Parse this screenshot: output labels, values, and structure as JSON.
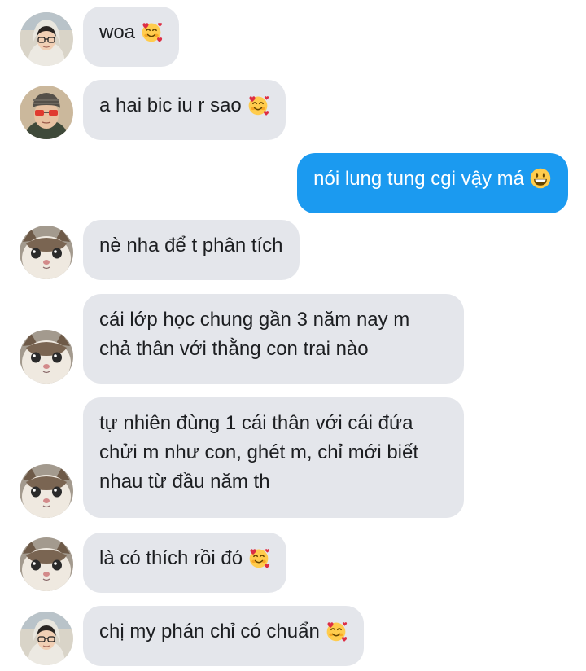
{
  "colors": {
    "incoming_bubble": "#e4e6eb",
    "outgoing_bubble": "#1b9af0",
    "incoming_text": "#1c1e21",
    "outgoing_text": "#ffffff"
  },
  "messages": [
    {
      "direction": "incoming",
      "avatar": "boy-hoodie-avatar",
      "lines": [
        "woa"
      ],
      "emoji": "smiling-face-with-hearts"
    },
    {
      "direction": "incoming",
      "avatar": "boy-red-glasses-avatar",
      "lines": [
        "a hai bic iu r sao"
      ],
      "emoji": "smiling-face-with-hearts"
    },
    {
      "direction": "outgoing",
      "lines": [
        "nói lung tung cgi vậy má"
      ],
      "emoji": "grinning-face"
    },
    {
      "direction": "incoming",
      "avatar": "cat-avatar",
      "lines": [
        "nè nha để t phân tích"
      ]
    },
    {
      "direction": "incoming",
      "avatar": "cat-avatar",
      "lines": [
        "cái lớp học chung gần 3 năm nay m",
        "chả thân với thằng con trai nào"
      ]
    },
    {
      "direction": "incoming",
      "avatar": "cat-avatar",
      "lines": [
        "tự nhiên đùng 1 cái thân với cái đứa",
        "chửi m như con, ghét m, chỉ mới biết",
        "nhau từ đầu năm th"
      ]
    },
    {
      "direction": "incoming",
      "avatar": "cat-avatar",
      "lines": [
        "là có thích rồi đó"
      ],
      "emoji": "smiling-face-with-hearts"
    },
    {
      "direction": "incoming",
      "avatar": "boy-hoodie-avatar",
      "lines": [
        "chị my phán chỉ có chuẩn"
      ],
      "emoji": "smiling-face-with-hearts"
    }
  ]
}
